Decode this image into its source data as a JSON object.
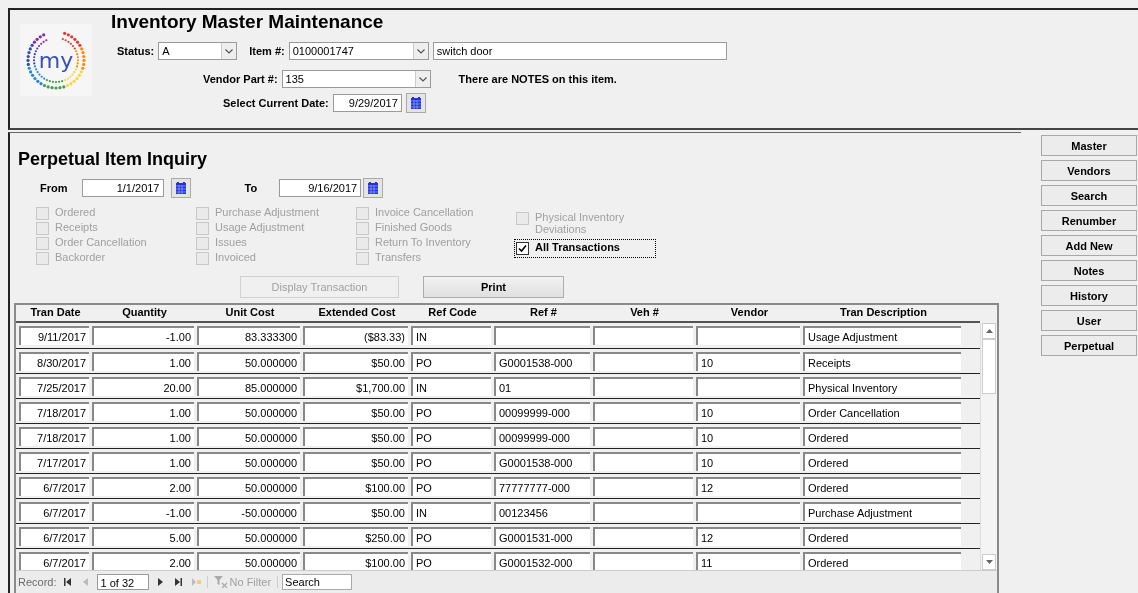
{
  "header": {
    "logo_text": "my",
    "title": "Inventory Master Maintenance",
    "status": {
      "label": "Status:",
      "value": "A"
    },
    "item": {
      "label": "Item #:",
      "value": "0100001747",
      "description": "switch door"
    },
    "vendor_part": {
      "label": "Vendor Part #:",
      "value": "135"
    },
    "notes_message": "There are NOTES on this item.",
    "current_date": {
      "label": "Select Current Date:",
      "value": "9/29/2017"
    }
  },
  "inquiry": {
    "title": "Perpetual Item Inquiry",
    "from": {
      "label": "From",
      "value": "1/1/2017"
    },
    "to": {
      "label": "To",
      "value": "9/16/2017"
    },
    "filter_columns": [
      [
        {
          "label": "Ordered",
          "checked": false,
          "disabled": true
        },
        {
          "label": "Receipts",
          "checked": false,
          "disabled": true
        },
        {
          "label": "Order Cancellation",
          "checked": false,
          "disabled": true
        },
        {
          "label": "Backorder",
          "checked": false,
          "disabled": true
        }
      ],
      [
        {
          "label": "Purchase Adjustment",
          "checked": false,
          "disabled": true
        },
        {
          "label": "Usage Adjustment",
          "checked": false,
          "disabled": true
        },
        {
          "label": "Issues",
          "checked": false,
          "disabled": true
        },
        {
          "label": "Invoiced",
          "checked": false,
          "disabled": true
        }
      ],
      [
        {
          "label": "Invoice Cancellation",
          "checked": false,
          "disabled": true
        },
        {
          "label": "Finished Goods",
          "checked": false,
          "disabled": true
        },
        {
          "label": "Return To Inventory",
          "checked": false,
          "disabled": true
        },
        {
          "label": "Transfers",
          "checked": false,
          "disabled": true
        }
      ],
      [
        {
          "label": "Physical Inventory Deviations",
          "checked": false,
          "disabled": true
        },
        {
          "label": "All Transactions",
          "checked": true,
          "disabled": false,
          "focused": true
        }
      ]
    ],
    "buttons": [
      {
        "label": "Display Transaction",
        "disabled": true
      },
      {
        "label": "Print",
        "disabled": false
      }
    ]
  },
  "table": {
    "columns": [
      "Tran Date",
      "Quantity",
      "Unit Cost",
      "Extended Cost",
      "Ref Code",
      "Ref #",
      "Veh #",
      "Vendor",
      "Tran Description"
    ],
    "rows": [
      [
        "9/11/2017",
        "-1.00",
        "83.333300",
        "($83.33)",
        "IN",
        "",
        "",
        "",
        "Usage Adjustment"
      ],
      [
        "8/30/2017",
        "1.00",
        "50.000000",
        "$50.00",
        "PO",
        "G0001538-000",
        "",
        "10",
        "Receipts"
      ],
      [
        "7/25/2017",
        "20.00",
        "85.000000",
        "$1,700.00",
        "IN",
        "01",
        "",
        "",
        "Physical Inventory"
      ],
      [
        "7/18/2017",
        "1.00",
        "50.000000",
        "$50.00",
        "PO",
        "00099999-000",
        "",
        "10",
        "Order Cancellation"
      ],
      [
        "7/18/2017",
        "1.00",
        "50.000000",
        "$50.00",
        "PO",
        "00099999-000",
        "",
        "10",
        "Ordered"
      ],
      [
        "7/17/2017",
        "1.00",
        "50.000000",
        "$50.00",
        "PO",
        "G0001538-000",
        "",
        "10",
        "Ordered"
      ],
      [
        "6/7/2017",
        "2.00",
        "50.000000",
        "$100.00",
        "PO",
        "77777777-000",
        "",
        "12",
        "Ordered"
      ],
      [
        "6/7/2017",
        "-1.00",
        "-50.000000",
        "$50.00",
        "IN",
        "00123456",
        "",
        "",
        "Purchase Adjustment"
      ],
      [
        "6/7/2017",
        "5.00",
        "50.000000",
        "$250.00",
        "PO",
        "G0001531-000",
        "",
        "12",
        "Ordered"
      ],
      [
        "6/7/2017",
        "2.00",
        "50.000000",
        "$100.00",
        "PO",
        "G0001532-000",
        "",
        "11",
        "Ordered"
      ]
    ]
  },
  "record_nav": {
    "label": "Record:",
    "position": "1 of 32",
    "nav_buttons": [
      {
        "kind": "first",
        "disabled": false
      },
      {
        "kind": "previous",
        "disabled": true
      }
    ],
    "nav_buttons_after": [
      {
        "kind": "next",
        "disabled": false
      },
      {
        "kind": "last",
        "disabled": false
      },
      {
        "kind": "new",
        "disabled": true
      }
    ],
    "filter": {
      "label": "No Filter",
      "disabled": true
    },
    "search": {
      "placeholder": "Search"
    }
  },
  "side_buttons": [
    "Master",
    "Vendors",
    "Search",
    "Renumber",
    "Add New",
    "Notes",
    "History",
    "User",
    "Perpetual"
  ]
}
